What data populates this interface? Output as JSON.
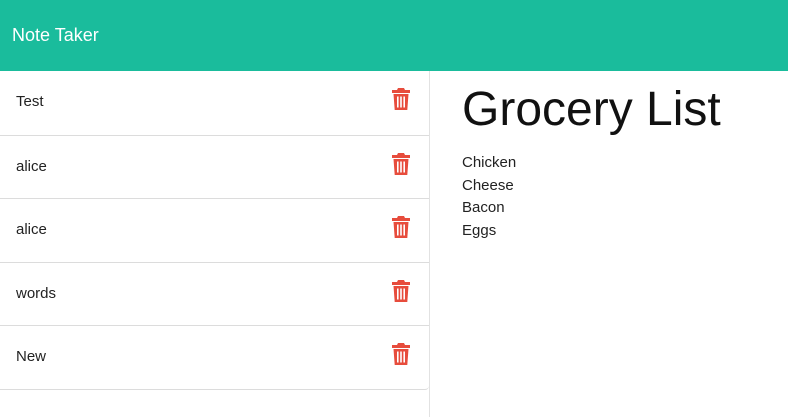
{
  "app": {
    "title": "Note Taker"
  },
  "colors": {
    "navbar": "#1abc9c",
    "delete_icon": "#e74c3c"
  },
  "notes": [
    {
      "title": "Test",
      "delete_icon": "trash-icon"
    },
    {
      "title": "alice",
      "delete_icon": "trash-icon"
    },
    {
      "title": "alice",
      "delete_icon": "trash-icon"
    },
    {
      "title": "words",
      "delete_icon": "trash-icon"
    },
    {
      "title": "New",
      "delete_icon": "trash-icon"
    }
  ],
  "editor": {
    "title_value": "Grocery List",
    "body_value": "Chicken\nCheese\nBacon\nEggs"
  }
}
